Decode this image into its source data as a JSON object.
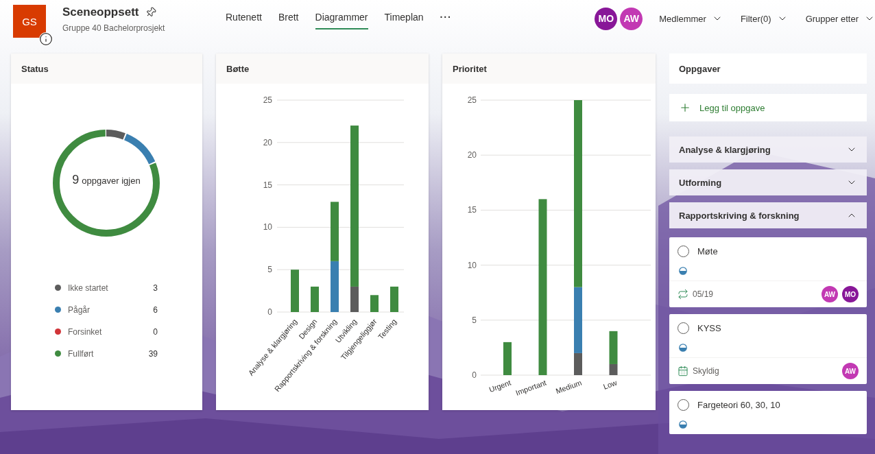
{
  "header": {
    "logo": "GS",
    "title": "Sceneoppsett",
    "subtitle": "Gruppe 40 Bachelorprosjekt",
    "more": "···",
    "tabs": [
      {
        "label": "Rutenett",
        "selected": false
      },
      {
        "label": "Brett",
        "selected": false
      },
      {
        "label": "Diagrammer",
        "selected": true
      },
      {
        "label": "Timeplan",
        "selected": false
      }
    ],
    "members": [
      {
        "initials": "MO",
        "color": "#881798"
      },
      {
        "initials": "AW",
        "color": "#c239b3"
      }
    ],
    "menus": [
      "Medlemmer",
      "Filter(0)",
      "Grupper etter"
    ]
  },
  "status": {
    "title": "Status",
    "remaining": "9",
    "remaining_label": "oppgaver igjen",
    "legend": [
      {
        "name": "Ikke startet",
        "count": "3",
        "color": "#5c5c5c"
      },
      {
        "name": "Pågår",
        "count": "6",
        "color": "#3a7fb0"
      },
      {
        "name": "Forsinket",
        "count": "0",
        "color": "#d13438"
      },
      {
        "name": "Fullført",
        "count": "39",
        "color": "#3f8b40"
      }
    ]
  },
  "bucket": {
    "title": "Bøtte",
    "chart_data": {
      "type": "bar",
      "stacked": true,
      "categories": [
        "Analyse & klargjøring",
        "Design",
        "Rapportskriving & forskning",
        "Utvikling",
        "Tilgjengeliggjør",
        "Testing"
      ],
      "yticks": [
        0,
        5,
        10,
        15,
        20,
        25
      ],
      "ylim": [
        0,
        25
      ],
      "grid": true,
      "series": [
        {
          "color": "#5c5c5c",
          "values": [
            0,
            0,
            0,
            3,
            0,
            0
          ]
        },
        {
          "color": "#3a7fb0",
          "values": [
            0,
            0,
            6,
            0,
            0,
            0
          ]
        },
        {
          "color": "#3f8b40",
          "values": [
            5,
            3,
            7,
            19,
            2,
            3
          ]
        }
      ]
    }
  },
  "priority": {
    "title": "Prioritet",
    "chart_data": {
      "type": "bar",
      "stacked": true,
      "categories": [
        "Urgent",
        "Important",
        "Medium",
        "Low"
      ],
      "yticks": [
        0,
        5,
        10,
        15,
        20,
        25
      ],
      "ylim": [
        0,
        25
      ],
      "grid": true,
      "series": [
        {
          "color": "#5c5c5c",
          "values": [
            0,
            0,
            2,
            1
          ]
        },
        {
          "color": "#3a7fb0",
          "values": [
            0,
            0,
            6,
            0
          ]
        },
        {
          "color": "#3f8b40",
          "values": [
            3,
            16,
            17,
            3
          ]
        }
      ]
    }
  },
  "tasks": {
    "title": "Oppgaver",
    "add_label": "Legg til oppgave",
    "groups": [
      {
        "name": "Analyse & klargjøring",
        "expanded": false
      },
      {
        "name": "Utforming",
        "expanded": false
      },
      {
        "name": "Rapportskriving & forskning",
        "expanded": true
      }
    ],
    "items": [
      {
        "title": "Møte",
        "checked": false,
        "footer": {
          "kind": "recurring",
          "text": "05/19"
        },
        "assignees": [
          {
            "initials": "AW",
            "color": "#c239b3"
          },
          {
            "initials": "MO",
            "color": "#881798"
          }
        ]
      },
      {
        "title": "KYSS",
        "checked": false,
        "footer": {
          "kind": "due",
          "text": "Skyldig"
        },
        "assignees": [
          {
            "initials": "AW",
            "color": "#c239b3"
          }
        ]
      },
      {
        "title": "Fargeteori 60, 30, 10",
        "checked": false
      }
    ]
  }
}
